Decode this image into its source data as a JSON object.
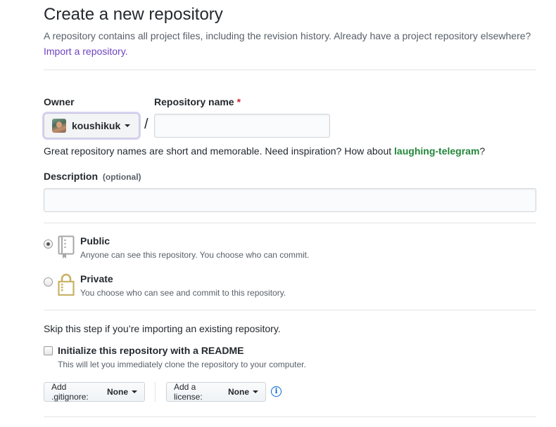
{
  "header": {
    "title": "Create a new repository",
    "description": "A repository contains all project files, including the revision history. Already have a project repository elsewhere?",
    "import_link": "Import a repository."
  },
  "owner": {
    "label": "Owner",
    "value": "koushikuk"
  },
  "repo_name": {
    "label": "Repository name",
    "required_mark": "*",
    "value": ""
  },
  "separator": "/",
  "suggestion": {
    "prefix": "Great repository names are short and memorable. Need inspiration? How about ",
    "name": "laughing-telegram",
    "suffix": "?"
  },
  "description_field": {
    "label": "Description",
    "optional": "(optional)",
    "value": ""
  },
  "visibility": {
    "public": {
      "title": "Public",
      "desc": "Anyone can see this repository. You choose who can commit.",
      "selected": true
    },
    "private": {
      "title": "Private",
      "desc": "You choose who can see and commit to this repository.",
      "selected": false
    }
  },
  "init": {
    "skip_note": "Skip this step if you’re importing an existing repository.",
    "readme_label": "Initialize this repository with a README",
    "readme_desc": "This will let you immediately clone the repository to your computer.",
    "readme_checked": false
  },
  "gitignore": {
    "prefix": "Add .gitignore:",
    "value": "None"
  },
  "license": {
    "prefix": "Add a license:",
    "value": "None"
  },
  "colors": {
    "link": "#6f42c1",
    "suggest": "#22863a",
    "required": "#cb2431",
    "info": "#0366d6"
  }
}
